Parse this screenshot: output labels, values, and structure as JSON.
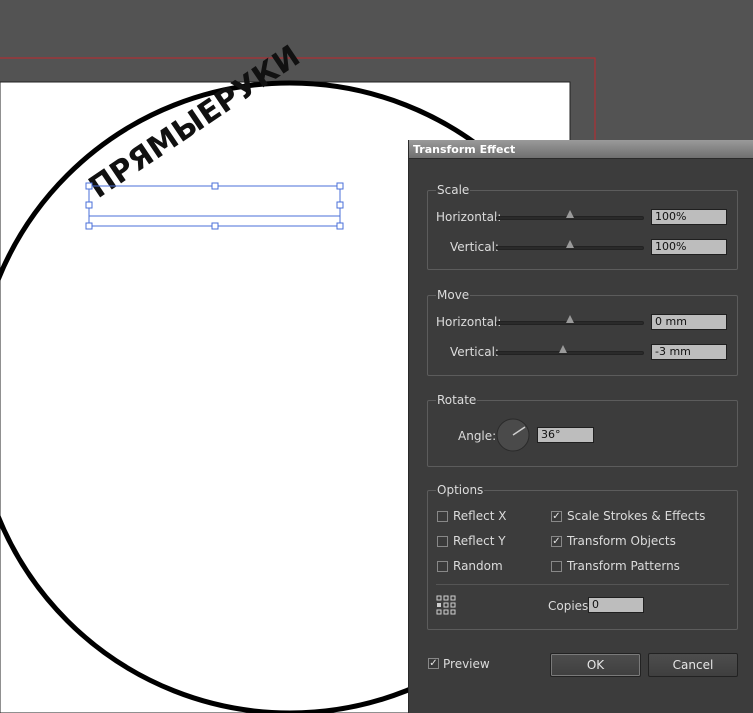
{
  "canvas": {
    "curved_text": "ПРЯМЫЕРУКИ"
  },
  "dialog": {
    "title": "Transform Effect",
    "scale": {
      "group_label": "Scale",
      "horizontal_label": "Horizontal:",
      "horizontal_value": "100%",
      "vertical_label": "Vertical:",
      "vertical_value": "100%"
    },
    "move": {
      "group_label": "Move",
      "horizontal_label": "Horizontal:",
      "horizontal_value": "0 mm",
      "vertical_label": "Vertical:",
      "vertical_value": "-3 mm"
    },
    "rotate": {
      "group_label": "Rotate",
      "angle_label": "Angle:",
      "angle_value": "36°"
    },
    "options": {
      "group_label": "Options",
      "reflect_x": "Reflect X",
      "reflect_y": "Reflect Y",
      "random": "Random",
      "scale_strokes": "Scale Strokes & Effects",
      "transform_objects": "Transform Objects",
      "transform_patterns": "Transform Patterns",
      "copies_label": "Copies",
      "copies_value": "0",
      "checked": {
        "reflect_x": false,
        "reflect_y": false,
        "random": false,
        "scale_strokes": true,
        "transform_objects": true,
        "transform_patterns": false
      }
    },
    "preview_label": "Preview",
    "preview_checked": true,
    "ok_label": "OK",
    "cancel_label": "Cancel"
  }
}
